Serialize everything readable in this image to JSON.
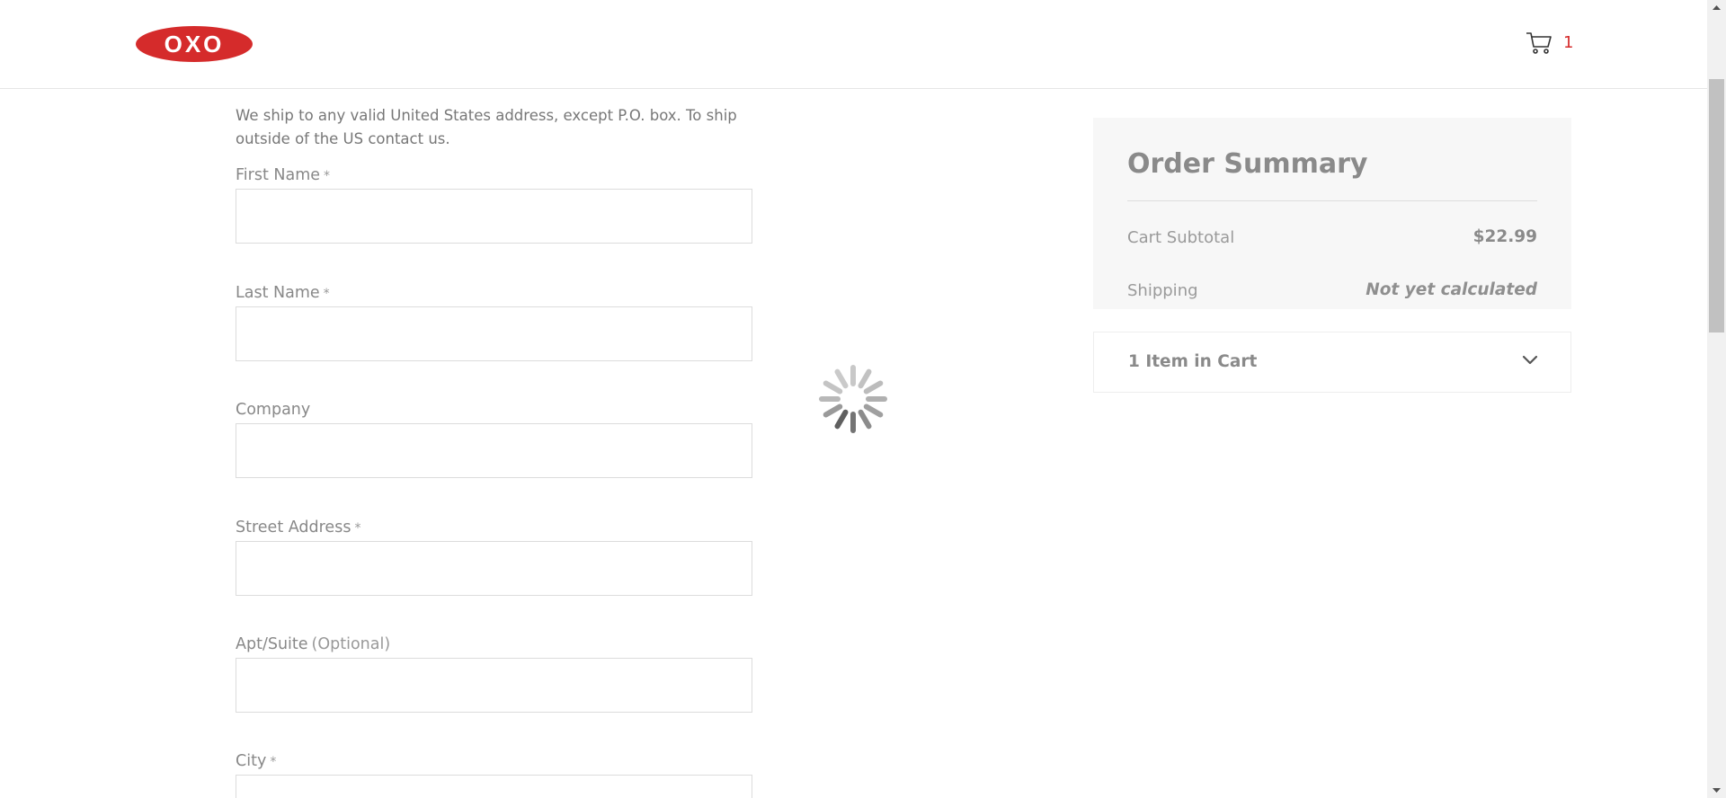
{
  "header": {
    "logo_text": "OXO",
    "cart_count": "1",
    "brand_color": "#d52b2b"
  },
  "form": {
    "intro": "We ship to any valid United States address, except P.O. box. To ship outside of the US contact us.",
    "required_marker": "*",
    "fields": {
      "first_name": {
        "label": "First Name",
        "value": ""
      },
      "last_name": {
        "label": "Last Name",
        "value": ""
      },
      "company": {
        "label": "Company",
        "value": ""
      },
      "street_address": {
        "label": "Street Address",
        "value": ""
      },
      "apt_suite": {
        "label": "Apt/Suite",
        "optional": "(Optional)",
        "value": ""
      },
      "city": {
        "label": "City",
        "value": ""
      }
    }
  },
  "summary": {
    "title": "Order Summary",
    "subtotal_label": "Cart Subtotal",
    "subtotal_value": "$22.99",
    "shipping_label": "Shipping",
    "shipping_value": "Not yet calculated",
    "items_in_cart": "1 Item in Cart"
  },
  "icons": {
    "cart": "cart-icon",
    "spinner": "loading-spinner-icon",
    "chevron": "chevron-down-icon"
  }
}
